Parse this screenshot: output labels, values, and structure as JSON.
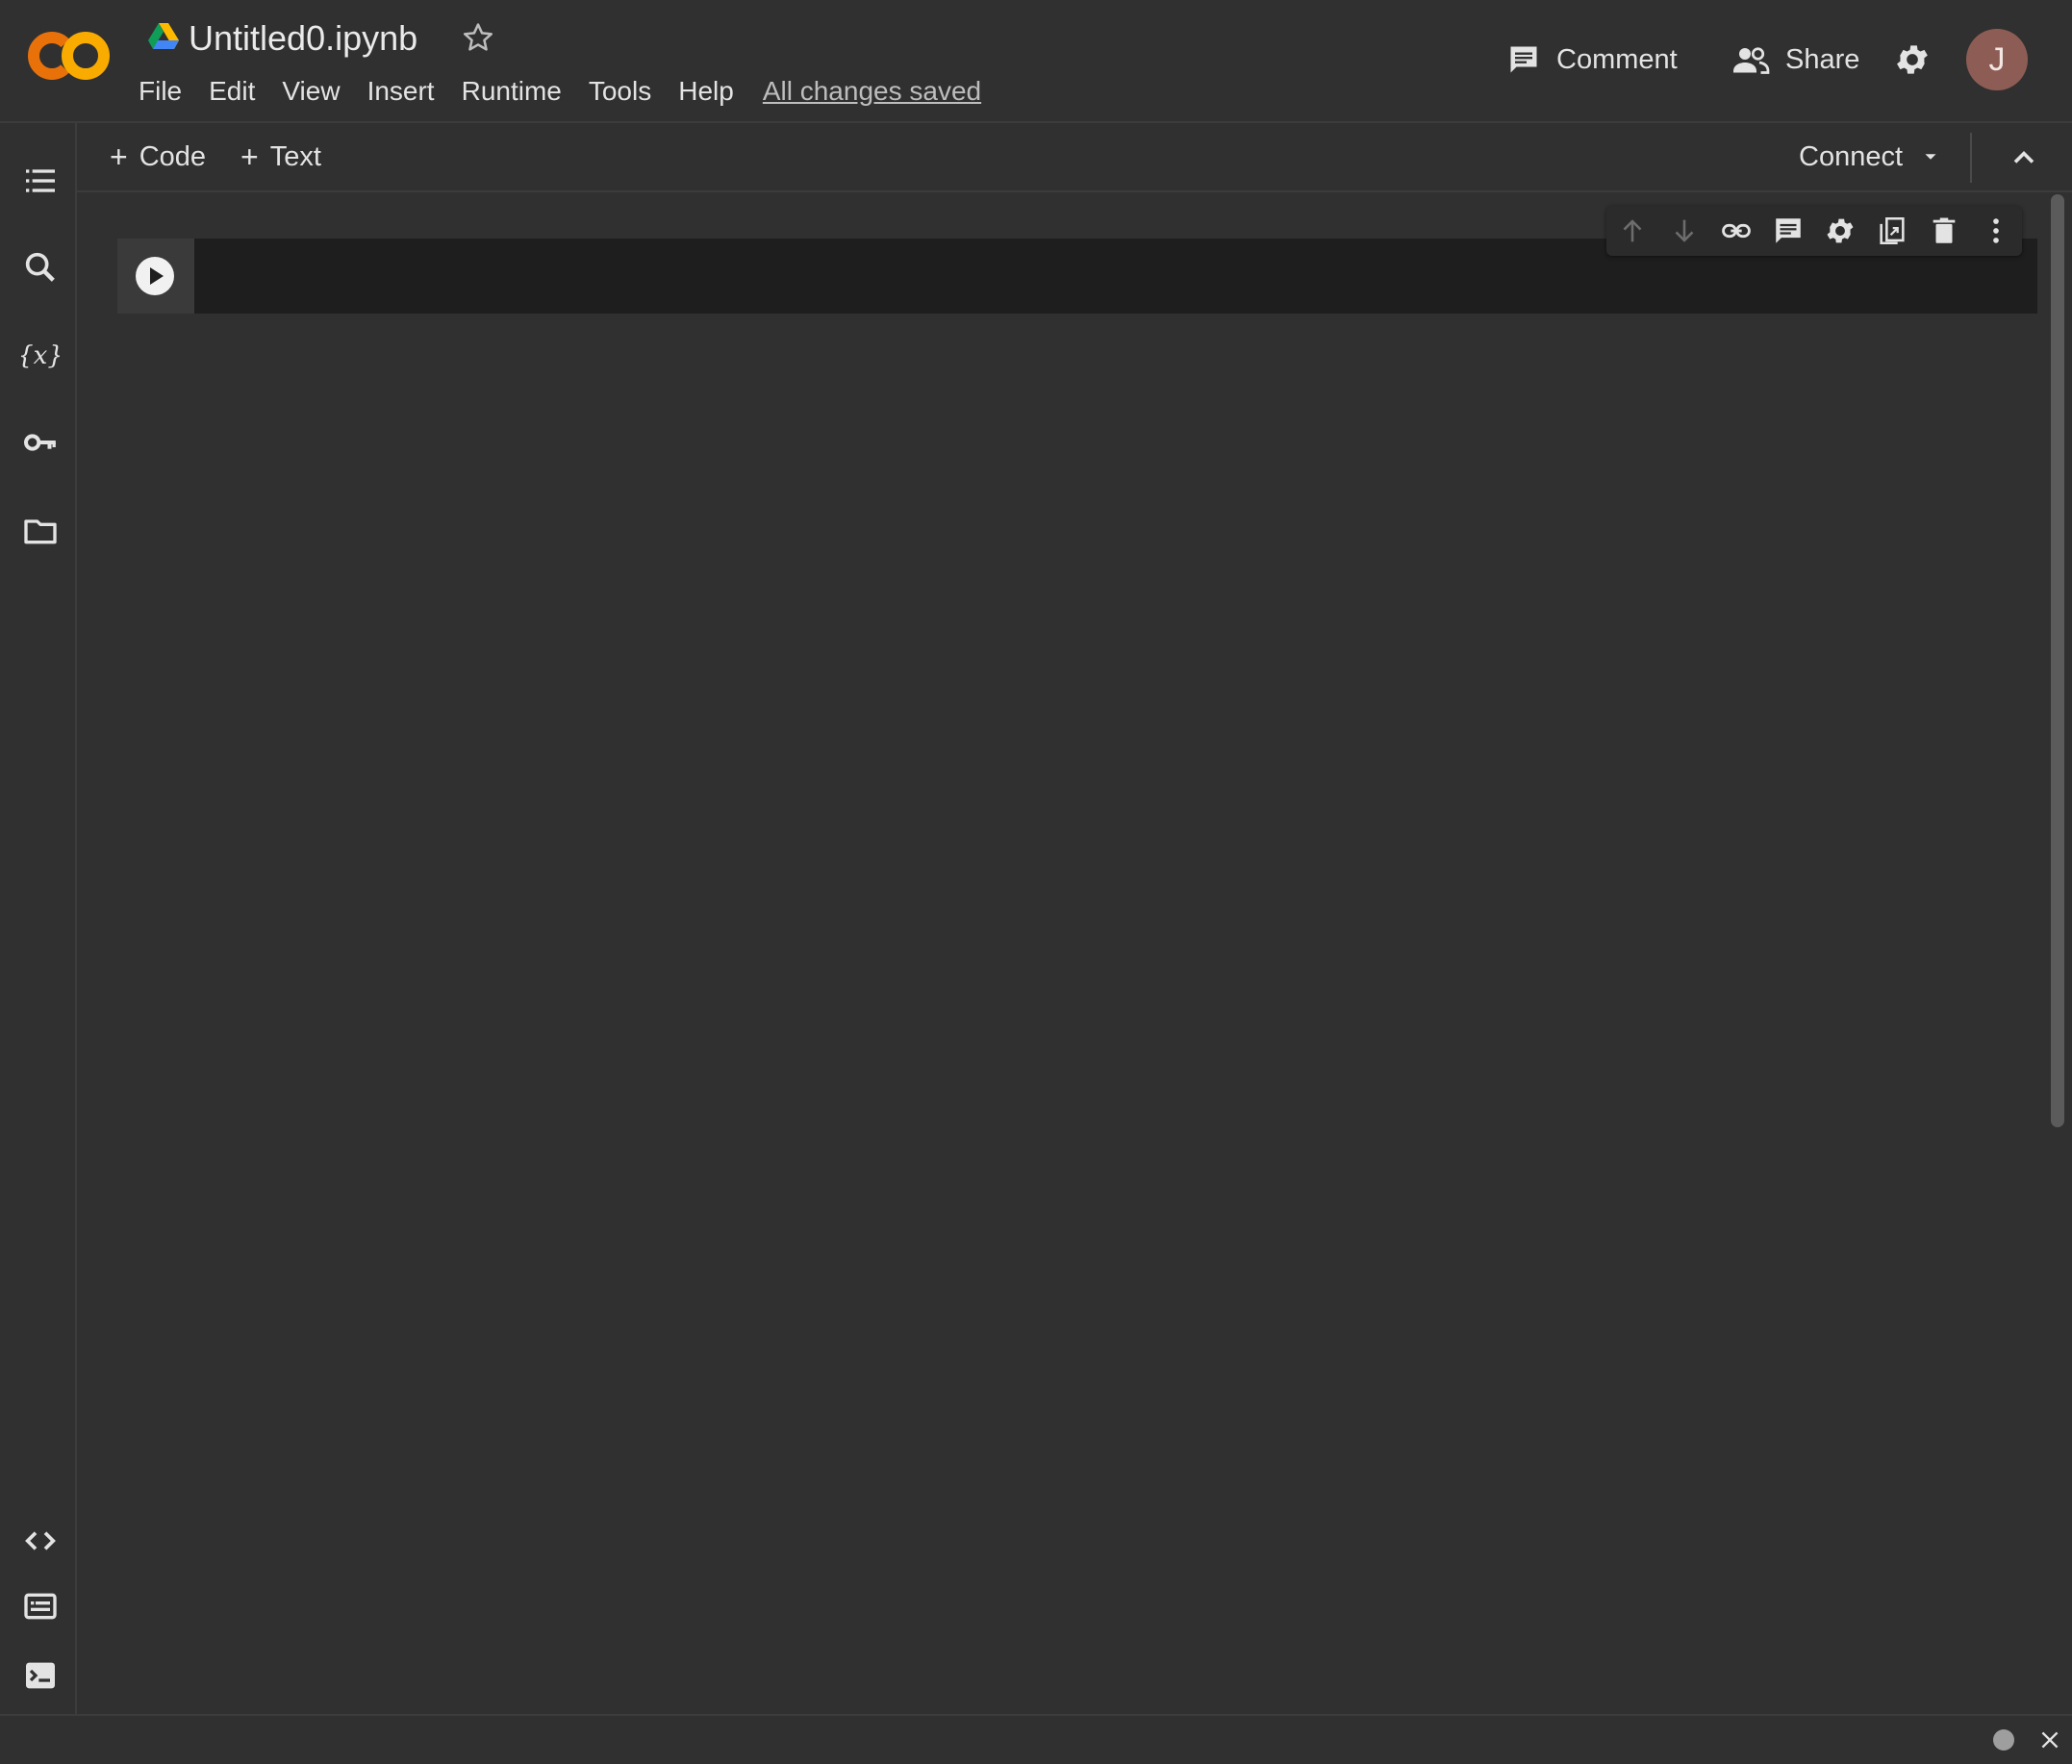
{
  "header": {
    "title": "Untitled0.ipynb",
    "save_status": "All changes saved",
    "menu": [
      "File",
      "Edit",
      "View",
      "Insert",
      "Runtime",
      "Tools",
      "Help"
    ],
    "comment_label": "Comment",
    "share_label": "Share",
    "avatar_initial": "J"
  },
  "toolbar": {
    "add_code_label": "Code",
    "add_text_label": "Text",
    "connect_label": "Connect"
  },
  "left_rail": {
    "icons": [
      "table-of-contents-icon",
      "search-icon",
      "variables-icon",
      "secrets-key-icon",
      "files-folder-icon",
      "code-snippets-icon",
      "command-palette-icon",
      "terminal-icon"
    ]
  },
  "cell_toolbar": {
    "icons": [
      "move-up-icon",
      "move-down-icon",
      "link-icon",
      "comment-icon",
      "settings-icon",
      "mirror-cell-icon",
      "delete-icon",
      "more-icon"
    ]
  },
  "colors": {
    "background": "#303030",
    "cell_background": "#1e1e1e",
    "logo_orange": "#f9ab00",
    "avatar": "#8d5d55"
  }
}
